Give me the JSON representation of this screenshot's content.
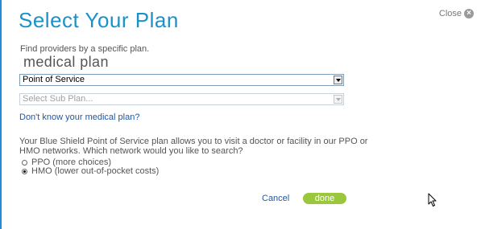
{
  "dialog": {
    "title": "Select Your Plan",
    "close_label": "Close",
    "close_icon": "close-icon",
    "subtitle": "Find providers by a specific plan.",
    "plan_label": "medical plan",
    "plan_select": {
      "value": "Point of Service"
    },
    "subplan_select": {
      "value": "Select Sub Plan..."
    },
    "help_link": "Don't know your medical plan?",
    "description": "Your Blue Shield Point of Service plan allows you to visit a doctor or facility in our PPO or HMO networks. Which network would you like to search?",
    "network_options": [
      {
        "label": "PPO (more choices)",
        "selected": false
      },
      {
        "label": "HMO (lower out-of-pocket costs)",
        "selected": true
      }
    ],
    "cancel_label": "Cancel",
    "done_label": "done"
  },
  "colors": {
    "title": "#1a92c9",
    "link": "#1f57a4",
    "done_button": "#9ac73c",
    "border_accent": "#1e8fd6"
  }
}
